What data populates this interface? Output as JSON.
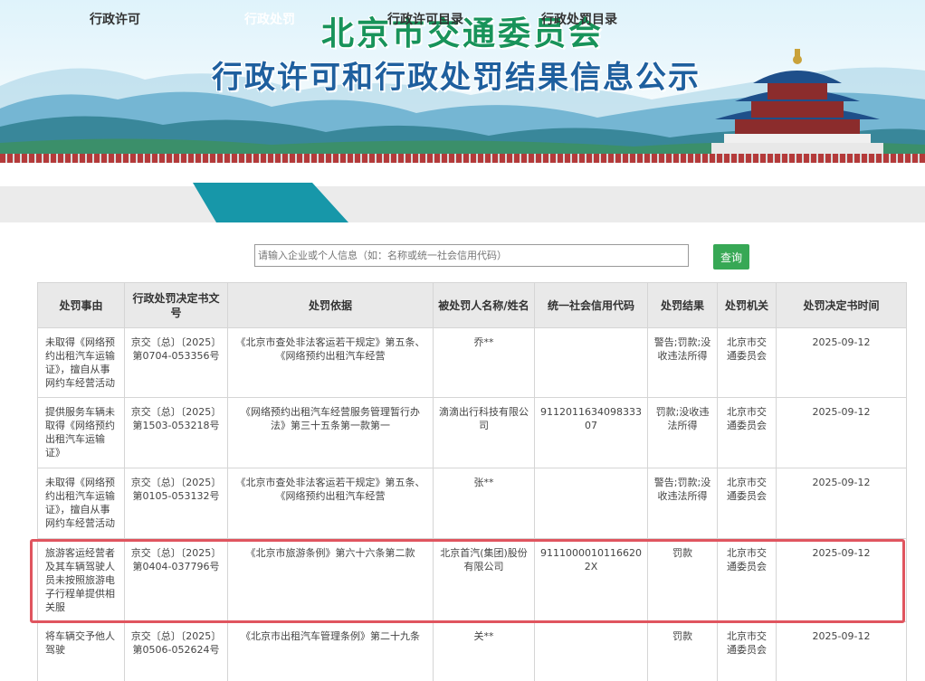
{
  "banner": {
    "title": "北京市交通委员会",
    "subtitle": "行政许可和行政处罚结果信息公示"
  },
  "tabs": [
    {
      "label": "行政许可",
      "active": false
    },
    {
      "label": "行政处罚",
      "active": true
    },
    {
      "label": "行政许可目录",
      "active": false
    },
    {
      "label": "行政处罚目录",
      "active": false
    }
  ],
  "search": {
    "placeholder": "请输入企业或个人信息（如：名称或统一社会信用代码）",
    "button_label": "查询"
  },
  "table": {
    "headers": [
      "处罚事由",
      "行政处罚决定书文号",
      "处罚依据",
      "被处罚人名称/姓名",
      "统一社会信用代码",
      "处罚结果",
      "处罚机关",
      "处罚决定书时间"
    ],
    "rows": [
      [
        "未取得《网络预约出租汽车运输证》，擅自从事网约车经营活动",
        "京交〔总〕〔2025〕第0704-053356号",
        "《北京市查处非法客运若干规定》第五条、《网络预约出租汽车经营",
        "乔**",
        "",
        "警告;罚款;没收违法所得",
        "北京市交通委员会",
        "2025-09-12"
      ],
      [
        "提供服务车辆未取得《网络预约出租汽车运输证》",
        "京交〔总〕〔2025〕第1503-053218号",
        "《网络预约出租汽车经营服务管理暂行办法》第三十五条第一款第一",
        "滴滴出行科技有限公司",
        "911201163409833307",
        "罚款;没收违法所得",
        "北京市交通委员会",
        "2025-09-12"
      ],
      [
        "未取得《网络预约出租汽车运输证》，擅自从事网约车经营活动",
        "京交〔总〕〔2025〕第0105-053132号",
        "《北京市查处非法客运若干规定》第五条、《网络预约出租汽车经营",
        "张**",
        "",
        "警告;罚款;没收违法所得",
        "北京市交通委员会",
        "2025-09-12"
      ],
      [
        "旅游客运经营者及其车辆驾驶人员未按照旅游电子行程单提供相关服",
        "京交〔总〕〔2025〕第0404-037796号",
        "《北京市旅游条例》第六十六条第二款",
        "北京首汽(集团)股份有限公司",
        "91110000101166202X",
        "罚款",
        "北京市交通委员会",
        "2025-09-12"
      ],
      [
        "将车辆交予他人驾驶",
        "京交〔总〕〔2025〕第0506-052624号",
        "《北京市出租汽车管理条例》第二十九条",
        "关**",
        "",
        "罚款",
        "北京市交通委员会",
        "2025-09-12"
      ]
    ]
  },
  "colors": {
    "accent": "#1797a9",
    "button": "#37a855",
    "highlight": "#e0555f"
  }
}
